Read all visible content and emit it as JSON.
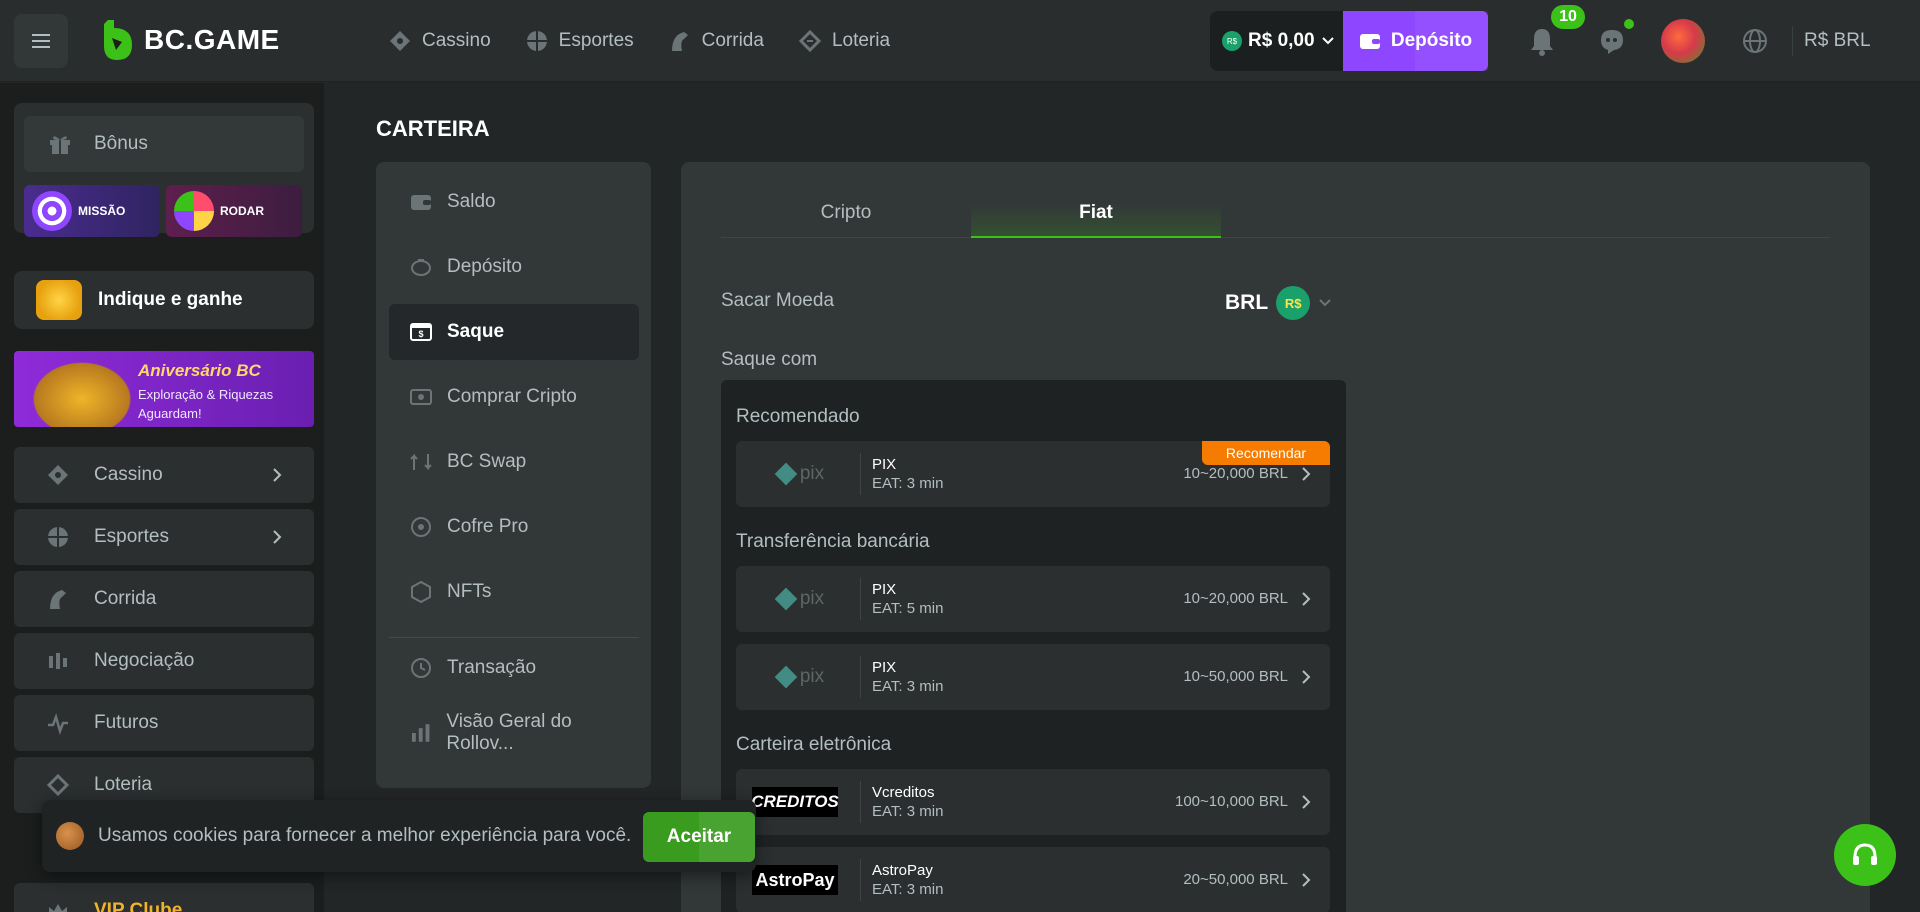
{
  "header": {
    "logo_text": "BC.GAME",
    "nav": [
      {
        "label": "Cassino",
        "icon": "casino-icon"
      },
      {
        "label": "Esportes",
        "icon": "sports-icon"
      },
      {
        "label": "Corrida",
        "icon": "racing-icon"
      },
      {
        "label": "Loteria",
        "icon": "lottery-icon"
      }
    ],
    "balance": "R$ 0,00",
    "coin_symbol": "R$",
    "deposit_label": "Depósito",
    "notification_count": "10",
    "currency": "R$ BRL"
  },
  "sidebar": {
    "bonus_label": "Bônus",
    "mission_label": "MISSÃO",
    "spin_label": "RODAR",
    "refer_label": "Indique e ganhe",
    "anniversary_title": "Aniversário BC",
    "anniversary_subtitle": "Exploração & Riquezas Aguardam!",
    "items": [
      {
        "label": "Cassino"
      },
      {
        "label": "Esportes"
      },
      {
        "label": "Corrida"
      },
      {
        "label": "Negociação"
      },
      {
        "label": "Futuros"
      },
      {
        "label": "Loteria"
      },
      {
        "label": "VIP Clube"
      }
    ]
  },
  "cookie": {
    "text": "Usamos cookies para fornecer a melhor experiência para você.",
    "accept_label": "Aceitar"
  },
  "page": {
    "title": "CARTEIRA"
  },
  "wallet_menu": {
    "items": [
      {
        "label": "Saldo"
      },
      {
        "label": "Depósito"
      },
      {
        "label": "Saque"
      },
      {
        "label": "Comprar Cripto"
      },
      {
        "label": "BC Swap"
      },
      {
        "label": "Cofre Pro"
      },
      {
        "label": "NFTs"
      },
      {
        "label": "Transação"
      },
      {
        "label": "Visão Geral do Rollov..."
      }
    ]
  },
  "withdraw": {
    "tabs": [
      {
        "label": "Cripto"
      },
      {
        "label": "Fiat"
      }
    ],
    "currency_label": "Sacar Moeda",
    "currency_value": "BRL",
    "coin_symbol": "R$",
    "method_label": "Saque com",
    "groups": [
      {
        "label": "Recomendado"
      },
      {
        "label": "Transferência bancária"
      },
      {
        "label": "Carteira eletrônica"
      }
    ],
    "recommend_tag": "Recomendar",
    "methods": [
      {
        "logo": "pix",
        "name": "PIX",
        "eat": "EAT: 3 min",
        "range": "10~20,000 BRL"
      },
      {
        "logo": "pix",
        "name": "PIX",
        "eat": "EAT: 5 min",
        "range": "10~20,000 BRL"
      },
      {
        "logo": "pix",
        "name": "PIX",
        "eat": "EAT: 3 min",
        "range": "10~50,000 BRL"
      },
      {
        "logo": "CREDITOS",
        "name": "Vcreditos",
        "eat": "EAT: 3 min",
        "range": "100~10,000 BRL"
      },
      {
        "logo": "AstroPay",
        "name": "AstroPay",
        "eat": "EAT: 3 min",
        "range": "20~50,000 BRL"
      }
    ]
  },
  "colors": {
    "accent_green": "#3bc117",
    "deposit_purple": "#8f46ff",
    "recommend_orange": "#f57c00"
  }
}
